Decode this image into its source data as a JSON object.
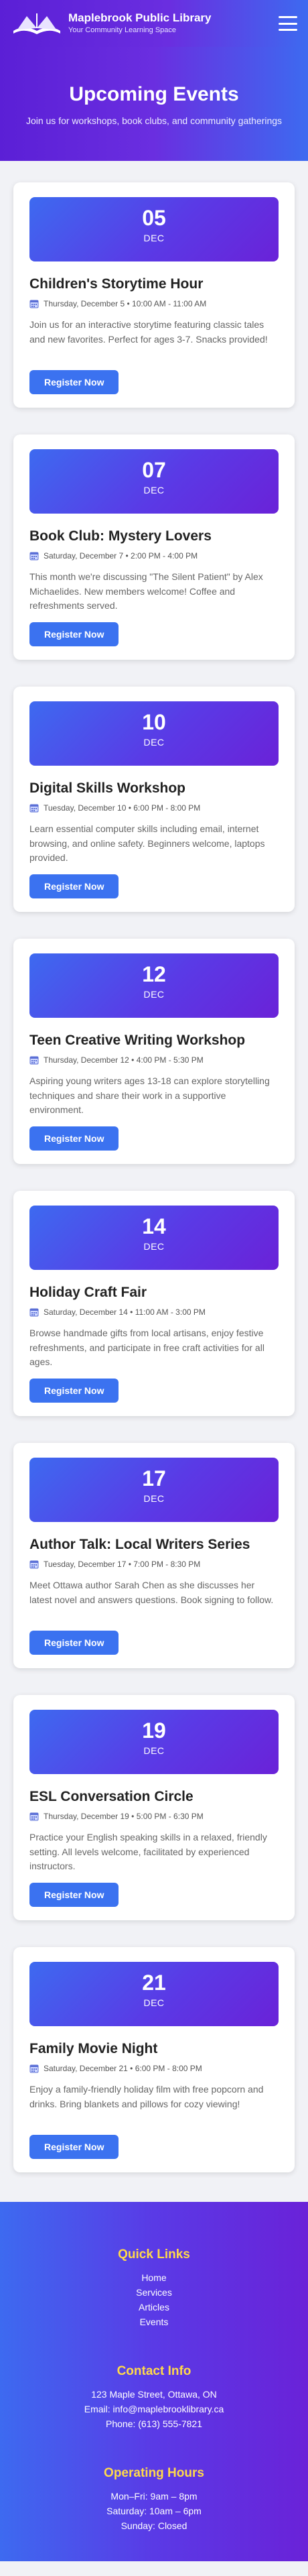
{
  "header": {
    "name": "Maplebrook Public Library",
    "tagline": "Your Community Learning Space"
  },
  "hero": {
    "title": "Upcoming Events",
    "subtitle": "Join us for workshops, book clubs, and community gatherings"
  },
  "events": [
    {
      "day": "05",
      "month": "DEC",
      "title": "Children's Storytime Hour",
      "meta": "Thursday, December 5 • 10:00 AM - 11:00 AM",
      "description": "Join us for an interactive storytime featuring classic tales and new favorites. Perfect for ages 3-7. Snacks provided!",
      "button": "Register Now"
    },
    {
      "day": "07",
      "month": "DEC",
      "title": "Book Club: Mystery Lovers",
      "meta": "Saturday, December 7 • 2:00 PM - 4:00 PM",
      "description": "This month we're discussing \"The Silent Patient\" by Alex Michaelides. New members welcome! Coffee and refreshments served.",
      "button": "Register Now"
    },
    {
      "day": "10",
      "month": "DEC",
      "title": "Digital Skills Workshop",
      "meta": "Tuesday, December 10 • 6:00 PM - 8:00 PM",
      "description": "Learn essential computer skills including email, internet browsing, and online safety. Beginners welcome, laptops provided.",
      "button": "Register Now"
    },
    {
      "day": "12",
      "month": "DEC",
      "title": "Teen Creative Writing Workshop",
      "meta": "Thursday, December 12 • 4:00 PM - 5:30 PM",
      "description": "Aspiring young writers ages 13-18 can explore storytelling techniques and share their work in a supportive environment.",
      "button": "Register Now"
    },
    {
      "day": "14",
      "month": "DEC",
      "title": "Holiday Craft Fair",
      "meta": "Saturday, December 14 • 11:00 AM - 3:00 PM",
      "description": "Browse handmade gifts from local artisans, enjoy festive refreshments, and participate in free craft activities for all ages.",
      "button": "Register Now"
    },
    {
      "day": "17",
      "month": "DEC",
      "title": "Author Talk: Local Writers Series",
      "meta": "Tuesday, December 17 • 7:00 PM - 8:30 PM",
      "description": "Meet Ottawa author Sarah Chen as she discusses her latest novel and answers questions. Book signing to follow.",
      "button": "Register Now"
    },
    {
      "day": "19",
      "month": "DEC",
      "title": "ESL Conversation Circle",
      "meta": "Thursday, December 19 • 5:00 PM - 6:30 PM",
      "description": "Practice your English speaking skills in a relaxed, friendly setting. All levels welcome, facilitated by experienced instructors.",
      "button": "Register Now"
    },
    {
      "day": "21",
      "month": "DEC",
      "title": "Family Movie Night",
      "meta": "Saturday, December 21 • 6:00 PM - 8:00 PM",
      "description": "Enjoy a family-friendly holiday film with free popcorn and drinks. Bring blankets and pillows for cozy viewing!",
      "button": "Register Now"
    }
  ],
  "footer": {
    "quick_links_title": "Quick Links",
    "links": [
      "Home",
      "Services",
      "Articles",
      "Events"
    ],
    "contact_title": "Contact Info",
    "contact": [
      "123 Maple Street, Ottawa, ON",
      "Email: info@maplebrooklibrary.ca",
      "Phone: (613) 555-7821"
    ],
    "hours_title": "Operating Hours",
    "hours": [
      "Mon–Fri: 9am – 8pm",
      "Saturday: 10am – 6pm",
      "Sunday: Closed"
    ]
  },
  "colors": {
    "brand_purple": "#5b1fd6",
    "brand_blue": "#3d6af0",
    "button_blue": "#3b72f0",
    "footer_heading": "#ffd94a"
  },
  "icons": {
    "logo": "open-book-icon",
    "menu": "hamburger-menu-icon",
    "event_meta": "calendar-icon"
  }
}
